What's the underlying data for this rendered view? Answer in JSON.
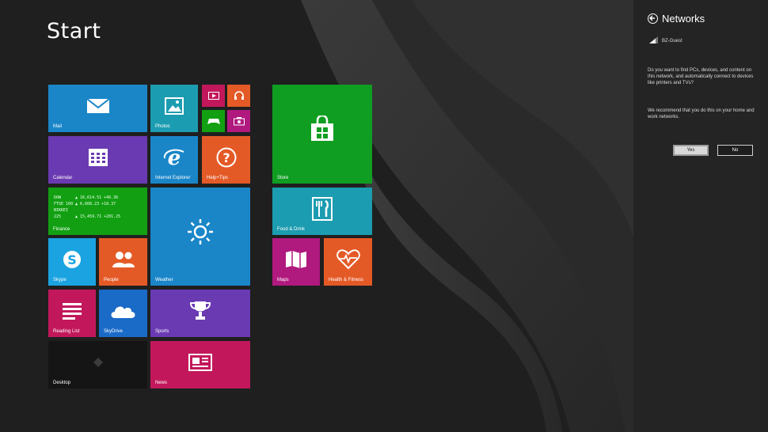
{
  "start": {
    "title": "Start"
  },
  "tiles": {
    "mail": "Mail",
    "photos": "Photos",
    "calendar": "Calendar",
    "ie": "Internet Explorer",
    "help": "Help+Tips",
    "store": "Store",
    "finance": "Finance",
    "finance_rows": [
      {
        "name": "DOW",
        "value": "▲ 16,614.51 +46.36"
      },
      {
        "name": "FTSE 100",
        "value": "▲ 6,668.23 +18.37"
      },
      {
        "name": "NIKKEI 225",
        "value": "▲ 15,459.71 +201.25"
      }
    ],
    "weather": "Weather",
    "food": "Food & Drink",
    "skype": "Skype",
    "people": "People",
    "maps": "Maps",
    "health": "Health & Fitness",
    "reading": "Reading List",
    "skydrive": "SkyDrive",
    "sports": "Sports",
    "desktop": "Desktop",
    "news": "News"
  },
  "colors": {
    "blue": "#1a86c8",
    "teal": "#1c9cb0",
    "crimson": "#c2185b",
    "orange": "#e45a27",
    "green": "#12a012",
    "magenta": "#b0197e",
    "purple": "#6a3ab2",
    "store_green": "#0f9e22"
  },
  "charm": {
    "title": "Networks",
    "network_name": "BZ-Guest",
    "question": "Do you want to find PCs, devices, and content on this network, and automatically connect to devices like printers and TVs?",
    "recommend": "We recommend that you do this on your home and work networks.",
    "yes_label": "Yes",
    "no_label": "No"
  }
}
